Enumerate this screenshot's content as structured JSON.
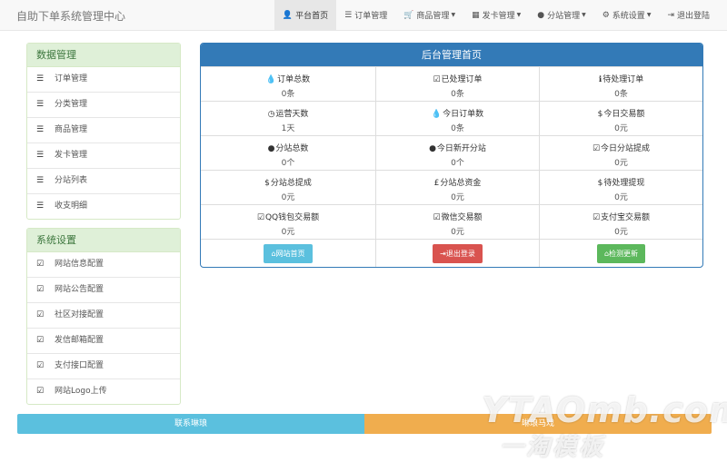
{
  "brand": "自助下单系统管理中心",
  "nav": [
    {
      "icon": "user-icon",
      "glyph": "👤",
      "label": "平台首页",
      "active": true,
      "caret": false
    },
    {
      "icon": "list-icon",
      "glyph": "☰",
      "label": "订单管理",
      "active": false,
      "caret": false
    },
    {
      "icon": "cart-icon",
      "glyph": "🛒",
      "label": "商品管理",
      "active": false,
      "caret": true
    },
    {
      "icon": "grid-icon",
      "glyph": "▦",
      "label": "发卡管理",
      "active": false,
      "caret": true
    },
    {
      "icon": "globe-icon",
      "glyph": "●",
      "label": "分站管理",
      "active": false,
      "caret": true
    },
    {
      "icon": "gear-icon",
      "glyph": "⚙",
      "label": "系统设置",
      "active": false,
      "caret": true
    },
    {
      "icon": "logout-icon",
      "glyph": "⇥",
      "label": "退出登陆",
      "active": false,
      "caret": false
    }
  ],
  "data_panel": {
    "title": "数据管理",
    "items": [
      "订单管理",
      "分类管理",
      "商品管理",
      "发卡管理",
      "分站列表",
      "收支明细"
    ]
  },
  "settings_panel": {
    "title": "系统设置",
    "items": [
      "网站信息配置",
      "网站公告配置",
      "社区对接配置",
      "发信邮箱配置",
      "支付接口配置",
      "网站Logo上传"
    ]
  },
  "main": {
    "title": "后台管理首页",
    "stats": [
      {
        "icon": "drop-icon",
        "glyph": "💧",
        "label": "订单总数",
        "value": "0条"
      },
      {
        "icon": "check-icon",
        "glyph": "☑",
        "label": "已处理订单",
        "value": "0条"
      },
      {
        "icon": "info-icon",
        "glyph": "ℹ",
        "label": "待处理订单",
        "value": "0条"
      },
      {
        "icon": "clock-icon",
        "glyph": "◷",
        "label": "运营天数",
        "value": "1天"
      },
      {
        "icon": "drop-icon",
        "glyph": "💧",
        "label": "今日订单数",
        "value": "0条"
      },
      {
        "icon": "dollar-icon",
        "glyph": "$",
        "label": "今日交易额",
        "value": "0元"
      },
      {
        "icon": "globe-icon",
        "glyph": "●",
        "label": "分站总数",
        "value": "0个"
      },
      {
        "icon": "globe-icon",
        "glyph": "●",
        "label": "今日新开分站",
        "value": "0个"
      },
      {
        "icon": "check-icon",
        "glyph": "☑",
        "label": "今日分站提成",
        "value": "0元"
      },
      {
        "icon": "dollar-icon",
        "glyph": "$",
        "label": "分站总提成",
        "value": "0元"
      },
      {
        "icon": "pound-icon",
        "glyph": "£",
        "label": "分站总资金",
        "value": "0元"
      },
      {
        "icon": "dollar-icon",
        "glyph": "$",
        "label": "待处理提现",
        "value": "0元"
      },
      {
        "icon": "check-icon",
        "glyph": "☑",
        "label": "QQ钱包交易额",
        "value": "0元"
      },
      {
        "icon": "check-icon",
        "glyph": "☑",
        "label": "微信交易额",
        "value": "0元"
      },
      {
        "icon": "check-icon",
        "glyph": "☑",
        "label": "支付宝交易额",
        "value": "0元"
      }
    ],
    "buttons": [
      {
        "icon": "home-icon",
        "glyph": "⌂",
        "label": "网站首页",
        "style": "info"
      },
      {
        "icon": "logout-icon",
        "glyph": "⇥",
        "label": "退出登录",
        "style": "danger"
      },
      {
        "icon": "home-icon",
        "glyph": "⌂",
        "label": "检测更新",
        "style": "success"
      }
    ]
  },
  "footer": {
    "left": "联系琳琅",
    "right": "琳琅马戏"
  },
  "watermark": {
    "line1": "YTAOmb.com",
    "line2": "一淘模板"
  }
}
